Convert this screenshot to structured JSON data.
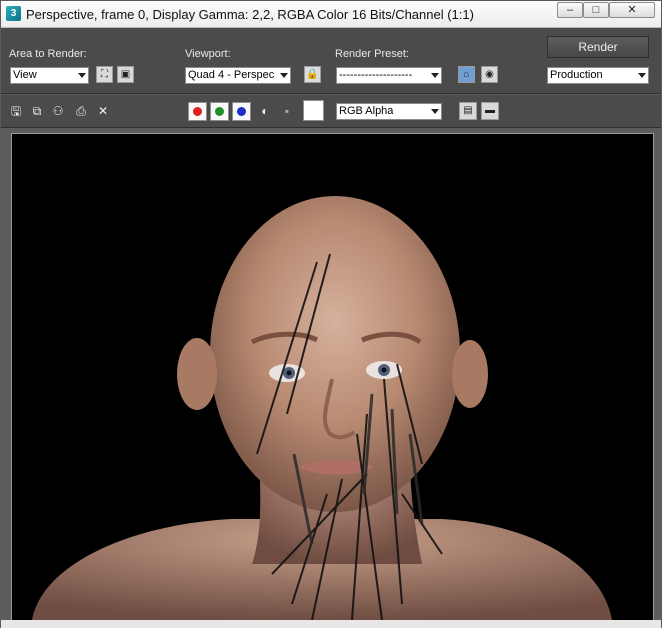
{
  "window": {
    "title": "Perspective, frame 0, Display Gamma: 2,2, RGBA Color 16 Bits/Channel (1:1)",
    "app_icon_glyph": "3",
    "controls": {
      "minimize": "–",
      "maximize": "□",
      "close": "✕"
    }
  },
  "render_settings": {
    "area_label": "Area to Render:",
    "area_value": "View",
    "viewport_label": "Viewport:",
    "viewport_value": "Quad 4 - Perspec",
    "preset_label": "Render Preset:",
    "preset_value": "--------------------",
    "render_button": "Render",
    "production_value": "Production"
  },
  "toolbar": {
    "channel_value": "RGB Alpha",
    "icons": [
      "save-image-icon",
      "copy-image-icon",
      "clone-window-icon",
      "print-icon",
      "clear-icon",
      "red-channel-icon",
      "green-channel-icon",
      "blue-channel-icon",
      "alpha-channel-icon",
      "monochrome-icon",
      "color-swatch-icon",
      "display-mode-icon",
      "frame-buffer-icon"
    ]
  },
  "colors": {
    "window_bg": "#5c5c5c",
    "panel_bg": "#4b4b4b",
    "active_button": "#6f9fd4",
    "red_channel": "#dd1f1f",
    "green_channel": "#1d8f23",
    "blue_channel": "#1c2fc0",
    "render_bg": "#000000"
  }
}
